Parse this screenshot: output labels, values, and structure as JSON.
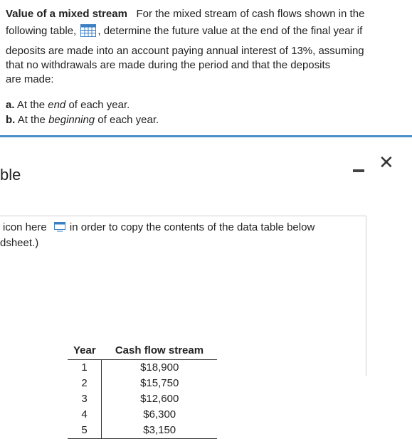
{
  "problem": {
    "title": "Value of a mixed stream",
    "line1_rest": "For the mixed stream of cash flows shown in the",
    "line2_a": "following table,",
    "line2_b": ", determine the future value at the end of the final year if",
    "line3": "deposits are made into an account paying annual interest of 13%, assuming",
    "line4": "that no withdrawals are made during the period and that the deposits",
    "line5": "are made:",
    "option_a": {
      "letter": "a.",
      "pre": "At the",
      "em": "end",
      "post": "of each year."
    },
    "option_b": {
      "letter": "b.",
      "pre": "At the",
      "em": "beginning",
      "post": "of each year."
    }
  },
  "popup": {
    "title": "ble",
    "close_label": "✕",
    "copy_line1_a": "icon here",
    "copy_line1_b": "in order to copy the contents of the data table below",
    "copy_line2": "dsheet.)"
  },
  "table": {
    "headers": [
      "Year",
      "Cash flow stream"
    ],
    "rows": [
      [
        "1",
        "$18,900"
      ],
      [
        "2",
        "$15,750"
      ],
      [
        "3",
        "$12,600"
      ],
      [
        "4",
        "$6,300"
      ],
      [
        "5",
        "$3,150"
      ]
    ]
  },
  "colors": {
    "accent": "#4a8fc9",
    "icon_blue": "#3b7fc4"
  }
}
